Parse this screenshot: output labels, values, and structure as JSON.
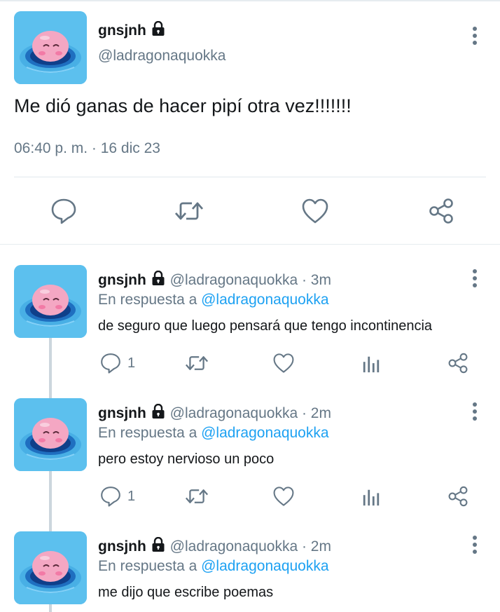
{
  "main_tweet": {
    "name": "gnsjnh",
    "handle": "@ladragonaquokka",
    "text": "Me dió ganas de hacer pipí otra vez!!!!!!!",
    "timestamp": "06:40 p. m. · 16 dic 23"
  },
  "replies": [
    {
      "name": "gnsjnh",
      "handle_time": "@ladragonaquokka · 3m",
      "reply_prefix": "En respuesta a ",
      "reply_mention": "@ladragonaquokka",
      "text": "de seguro que luego pensará que tengo incontinencia",
      "reply_count": "1"
    },
    {
      "name": "gnsjnh",
      "handle_time": "@ladragonaquokka · 2m",
      "reply_prefix": "En respuesta a ",
      "reply_mention": "@ladragonaquokka",
      "text": "pero estoy nervioso un poco",
      "reply_count": "1"
    },
    {
      "name": "gnsjnh",
      "handle_time": "@ladragonaquokka · 2m",
      "reply_prefix": "En respuesta a ",
      "reply_mention": "@ladragonaquokka",
      "text": "me dijo que escribe poemas"
    }
  ],
  "icons": {
    "avatar": "pink-blob-in-water",
    "lock": "lock-icon",
    "more": "more-vertical-icon",
    "reply": "reply-icon",
    "retweet": "retweet-icon",
    "like": "heart-icon",
    "analytics": "analytics-icon",
    "share": "share-icon"
  },
  "colors": {
    "text": "#14171a",
    "secondary": "#657786",
    "link": "#1da1f2",
    "divider": "#e1e8ed"
  }
}
